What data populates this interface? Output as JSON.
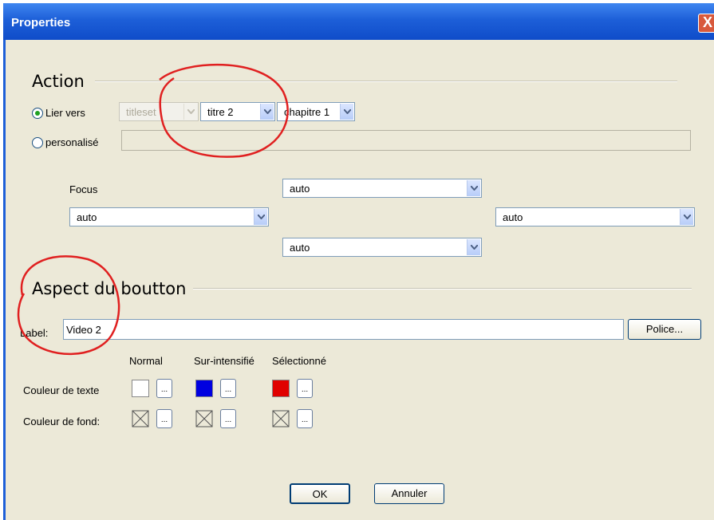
{
  "window": {
    "title": "Properties",
    "close": "X"
  },
  "action": {
    "heading": "Action",
    "link_radio_label": "Lier vers",
    "custom_radio_label": "personalisé",
    "titleset_value": "titleset",
    "titre_value": "titre 2",
    "chapitre_value": "chapitre 1",
    "focus_label": "Focus",
    "focus_top": "auto",
    "focus_left": "auto",
    "focus_right": "auto",
    "focus_bottom": "auto"
  },
  "aspect": {
    "heading": "Aspect du boutton",
    "label_caption": "Label:",
    "label_value": "Video 2",
    "font_button": "Police...",
    "col_normal": "Normal",
    "col_highlight": "Sur-intensifié",
    "col_selected": "Sélectionné",
    "text_color_label": "Couleur de texte",
    "bg_color_label": "Couleur de fond:",
    "dots_label": "...",
    "text_colors": {
      "normal": "#ffffff",
      "highlight": "#0000e0",
      "selected": "#e00000"
    }
  },
  "footer": {
    "ok_label": "OK",
    "cancel_label": "Annuler"
  },
  "annotation_color": "#e02020"
}
